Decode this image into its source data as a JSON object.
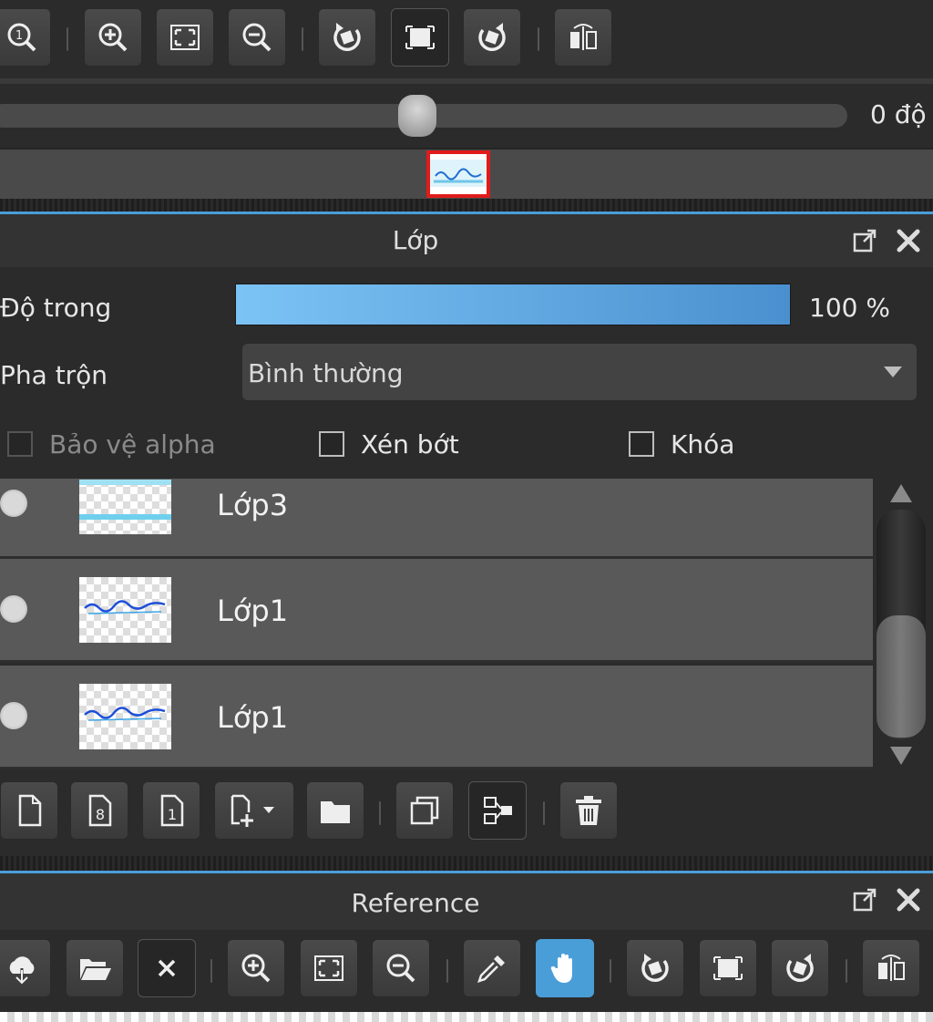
{
  "rotation": {
    "value_text": "0 độ",
    "position_fraction": 0.5
  },
  "layer_panel": {
    "title": "Lớp",
    "opacity_label": "Độ trong",
    "opacity_value_text": "100 %",
    "blend_label": "Pha trộn",
    "blend_value": "Bình thường",
    "protect_alpha_label": "Bảo vệ alpha",
    "clip_label": "Xén bớt",
    "lock_label": "Khóa",
    "layers": [
      {
        "name": "Lớp3"
      },
      {
        "name": "Lớp1"
      },
      {
        "name": "Lớp1"
      }
    ]
  },
  "reference_panel": {
    "title": "Reference"
  },
  "colors": {
    "accent": "#4a9ed8",
    "selection_frame": "#e01b1b",
    "opacity_fill_start": "#7cc3f5",
    "opacity_fill_end": "#4a90cf"
  }
}
